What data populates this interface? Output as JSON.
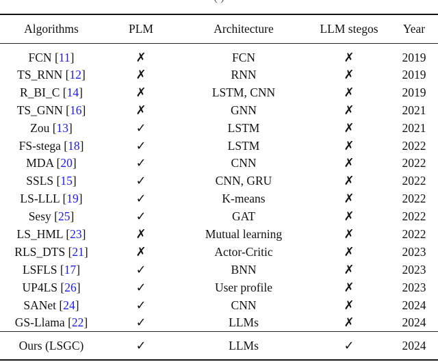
{
  "caption_fragment": "( )",
  "table": {
    "headers": [
      "Algorithms",
      "PLM",
      "Architecture",
      "LLM stegos",
      "Year"
    ],
    "rows": [
      {
        "name": "FCN",
        "cite": "11",
        "plm": "✗",
        "arch": "FCN",
        "llm": "✗",
        "year": "2019"
      },
      {
        "name": "TS_RNN",
        "cite": "12",
        "plm": "✗",
        "arch": "RNN",
        "llm": "✗",
        "year": "2019"
      },
      {
        "name": "R_BI_C",
        "cite": "14",
        "plm": "✗",
        "arch": "LSTM, CNN",
        "llm": "✗",
        "year": "2019"
      },
      {
        "name": "TS_GNN",
        "cite": "16",
        "plm": "✗",
        "arch": "GNN",
        "llm": "✗",
        "year": "2021"
      },
      {
        "name": "Zou",
        "cite": "13",
        "plm": "✓",
        "arch": "LSTM",
        "llm": "✗",
        "year": "2021"
      },
      {
        "name": "FS-stega",
        "cite": "18",
        "plm": "✓",
        "arch": "LSTM",
        "llm": "✗",
        "year": "2022"
      },
      {
        "name": "MDA",
        "cite": "20",
        "plm": "✓",
        "arch": "CNN",
        "llm": "✗",
        "year": "2022"
      },
      {
        "name": "SSLS",
        "cite": "15",
        "plm": "✓",
        "arch": "CNN, GRU",
        "llm": "✗",
        "year": "2022"
      },
      {
        "name": "LS-LLL",
        "cite": "19",
        "plm": "✓",
        "arch": "K-means",
        "llm": "✗",
        "year": "2022"
      },
      {
        "name": "Sesy",
        "cite": "25",
        "plm": "✓",
        "arch": "GAT",
        "llm": "✗",
        "year": "2022"
      },
      {
        "name": "LS_HML",
        "cite": "23",
        "plm": "✗",
        "arch": "Mutual learning",
        "llm": "✗",
        "year": "2022"
      },
      {
        "name": "RLS_DTS",
        "cite": "21",
        "plm": "✗",
        "arch": "Actor-Critic",
        "llm": "✗",
        "year": "2023"
      },
      {
        "name": "LSFLS",
        "cite": "17",
        "plm": "✓",
        "arch": "BNN",
        "llm": "✗",
        "year": "2023"
      },
      {
        "name": "UP4LS",
        "cite": "26",
        "plm": "✓",
        "arch": "User profile",
        "llm": "✗",
        "year": "2023"
      },
      {
        "name": "SANet",
        "cite": "24",
        "plm": "✓",
        "arch": "CNN",
        "llm": "✗",
        "year": "2024"
      },
      {
        "name": "GS-Llama",
        "cite": "22",
        "plm": "✓",
        "arch": "LLMs",
        "llm": "✗",
        "year": "2024"
      }
    ],
    "ours": {
      "name": "Ours (LSGC)",
      "plm": "✓",
      "arch": "LLMs",
      "llm": "✓",
      "year": "2024"
    }
  },
  "colors": {
    "citation": "#1a1aee",
    "rule": "#111111"
  }
}
